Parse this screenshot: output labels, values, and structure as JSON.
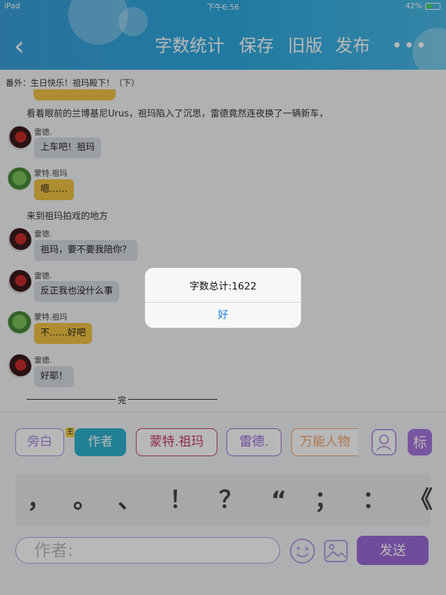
{
  "status": {
    "device": "iPad",
    "time": "下午6:56",
    "battery": "42%"
  },
  "header": {
    "buttons": [
      "字数统计",
      "保存",
      "旧版",
      "发布"
    ],
    "more": "•••"
  },
  "subtitle": "番外：生日快乐！祖玛殿下！（下）",
  "messages": [
    {
      "type": "narration",
      "text": "看着眼前的兰博基尼Urus，祖玛陷入了沉思，雷德竟然连夜换了一辆新车，"
    },
    {
      "type": "chat",
      "name": "雷德.",
      "text": "上车吧！祖玛",
      "color": "gray"
    },
    {
      "type": "chat",
      "name": "蒙特.祖玛",
      "text": "嗯……",
      "color": "yellow"
    },
    {
      "type": "narration",
      "text": "来到祖玛拍戏的地方"
    },
    {
      "type": "chat",
      "name": "雷德.",
      "text": "祖玛，要不要我陪你？",
      "color": "gray"
    },
    {
      "type": "chat",
      "name": "雷德.",
      "text": "反正我也没什么事",
      "color": "gray"
    },
    {
      "type": "chat",
      "name": "蒙特.祖玛",
      "text": "不……好吧",
      "color": "yellow"
    },
    {
      "type": "chat",
      "name": "雷德.",
      "text": "好耶！",
      "color": "gray"
    }
  ],
  "end_text": "完",
  "roles": {
    "items": [
      {
        "label": "旁白",
        "color": "#a98bdd"
      },
      {
        "label": "作者",
        "color": "#2eb2cf"
      },
      {
        "label": "蒙特.祖玛",
        "color": "#c63872"
      },
      {
        "label": "雷德.",
        "color": "#9b6ad8"
      },
      {
        "label": "万能人物",
        "color": "#f2a26a"
      }
    ],
    "main_mark": "主",
    "tag_button": "标"
  },
  "punctuation": [
    "，",
    "。",
    "、",
    "！",
    "？",
    "“",
    "；",
    "：",
    "《"
  ],
  "composer": {
    "placeholder": "作者:",
    "send": "发送"
  },
  "dialog": {
    "message": "字数总计:1622",
    "ok": "好"
  },
  "colors": {
    "header": "#2ea9e0",
    "send": "#9b6ad8",
    "ok": "#1a7ee6"
  }
}
